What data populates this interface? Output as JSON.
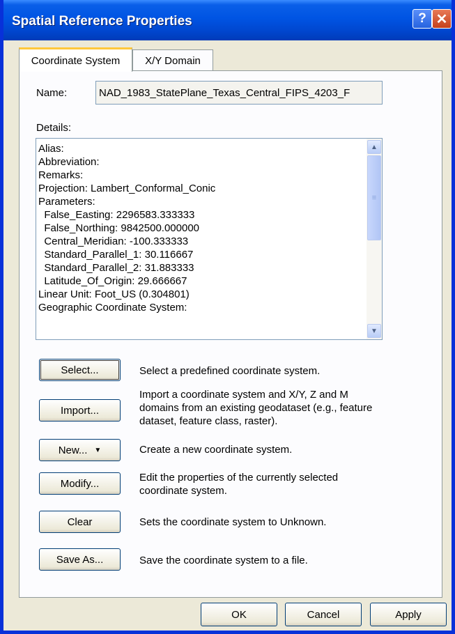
{
  "window": {
    "title": "Spatial Reference Properties",
    "help_glyph": "?",
    "close_glyph": "✕"
  },
  "tabs": [
    {
      "label": "Coordinate System",
      "active": true
    },
    {
      "label": "X/Y Domain",
      "active": false
    }
  ],
  "name": {
    "label": "Name:",
    "value": "NAD_1983_StatePlane_Texas_Central_FIPS_4203_F"
  },
  "details": {
    "label": "Details:",
    "lines": [
      "Alias:",
      "Abbreviation:",
      "Remarks:",
      "Projection: Lambert_Conformal_Conic",
      "Parameters:",
      "  False_Easting: 2296583.333333",
      "  False_Northing: 9842500.000000",
      "  Central_Meridian: -100.333333",
      "  Standard_Parallel_1: 30.116667",
      "  Standard_Parallel_2: 31.883333",
      "  Latitude_Of_Origin: 29.666667",
      "Linear Unit: Foot_US (0.304801)",
      "Geographic Coordinate System:"
    ]
  },
  "actions": [
    {
      "label": "Select...",
      "description": "Select a predefined coordinate system."
    },
    {
      "label": "Import...",
      "description": "Import a coordinate system and X/Y, Z and M domains from an existing geodataset (e.g., feature dataset, feature class, raster)."
    },
    {
      "label": "New...",
      "description": "Create a new coordinate system."
    },
    {
      "label": "Modify...",
      "description": "Edit the properties of the currently selected coordinate system."
    },
    {
      "label": "Clear",
      "description": "Sets the coordinate system to Unknown."
    },
    {
      "label": "Save As...",
      "description": "Save the coordinate system to a file."
    }
  ],
  "footer": {
    "ok": "OK",
    "cancel": "Cancel",
    "apply": "Apply"
  },
  "colors": {
    "titlebar": "#0054e3",
    "frame": "#0831d9",
    "dialog_bg": "#ece9d8",
    "tab_highlight": "#ffc83c"
  }
}
